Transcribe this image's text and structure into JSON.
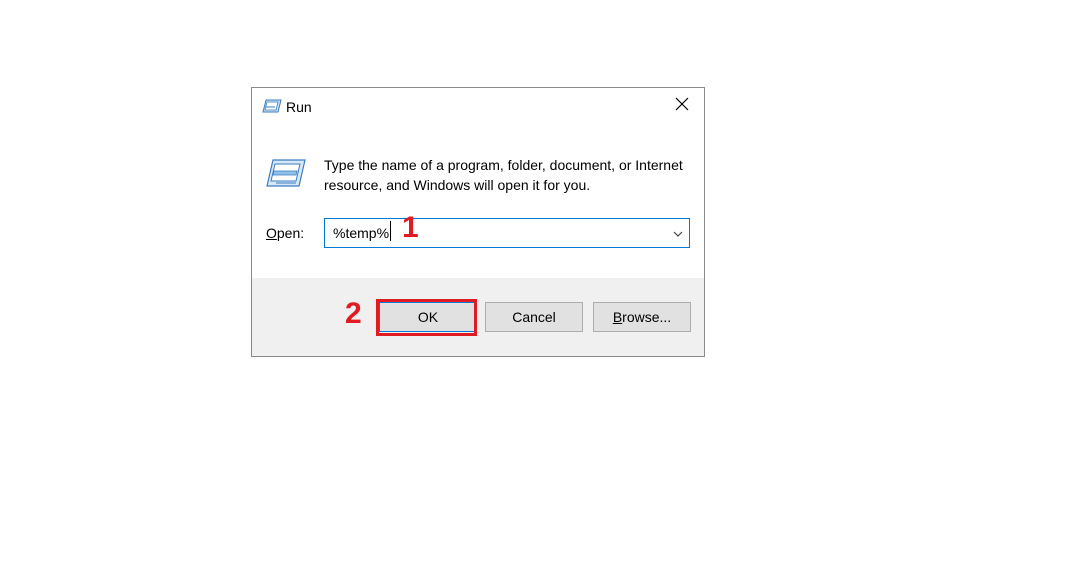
{
  "dialog": {
    "title": "Run",
    "description": "Type the name of a program, folder, document, or Internet resource, and Windows will open it for you.",
    "open_label_accel": "O",
    "open_label_rest": "pen:",
    "input_value": "%temp%",
    "buttons": {
      "ok": "OK",
      "cancel": "Cancel",
      "browse_accel": "B",
      "browse_rest": "rowse..."
    }
  },
  "annotations": {
    "step1": "1",
    "step2": "2",
    "highlight_color": "#e11b22"
  },
  "colors": {
    "focus_border": "#0078d7",
    "footer_bg": "#f0f0f0",
    "button_bg": "#e1e1e1"
  },
  "icons": {
    "title": "run-icon",
    "close": "close-icon",
    "dropdown": "chevron-down-icon"
  }
}
